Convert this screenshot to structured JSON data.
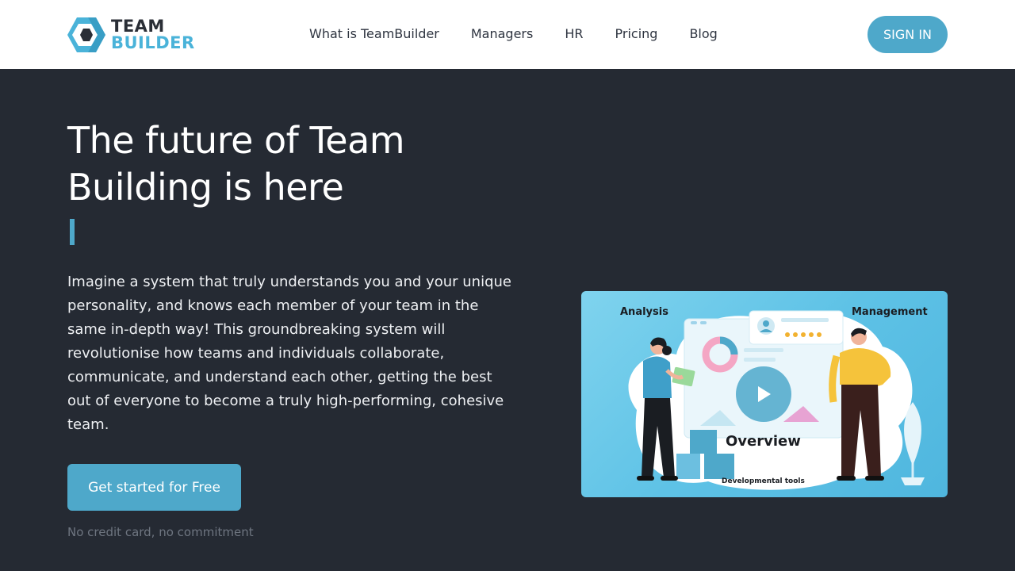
{
  "header": {
    "logo": {
      "line1": "TEAM",
      "line2": "BUILDER"
    },
    "nav": [
      {
        "label": "What is TeamBuilder"
      },
      {
        "label": "Managers"
      },
      {
        "label": "HR"
      },
      {
        "label": "Pricing"
      },
      {
        "label": "Blog"
      }
    ],
    "signin_label": "SIGN IN"
  },
  "hero": {
    "title": "The future of Team Building is here",
    "description": "Imagine a system that truly understands you and your unique personality, and knows each member of your team in the same in-depth way! This groundbreaking system will revolutionise how teams and individuals collaborate, communicate, and understand each other, getting the best out of everyone to become a truly high-performing, cohesive team.",
    "cta_label": "Get started for Free",
    "cta_note": "No credit card, no commitment"
  },
  "video": {
    "label_analysis": "Analysis",
    "label_management": "Management",
    "label_overview": "Overview",
    "label_devtools": "Developmental tools",
    "play_icon": "play-icon"
  },
  "colors": {
    "accent": "#4ea8ca",
    "background": "#252a33",
    "header_bg": "#ffffff",
    "logo_dark": "#2a2e36",
    "logo_blue": "#4ab3d9"
  }
}
